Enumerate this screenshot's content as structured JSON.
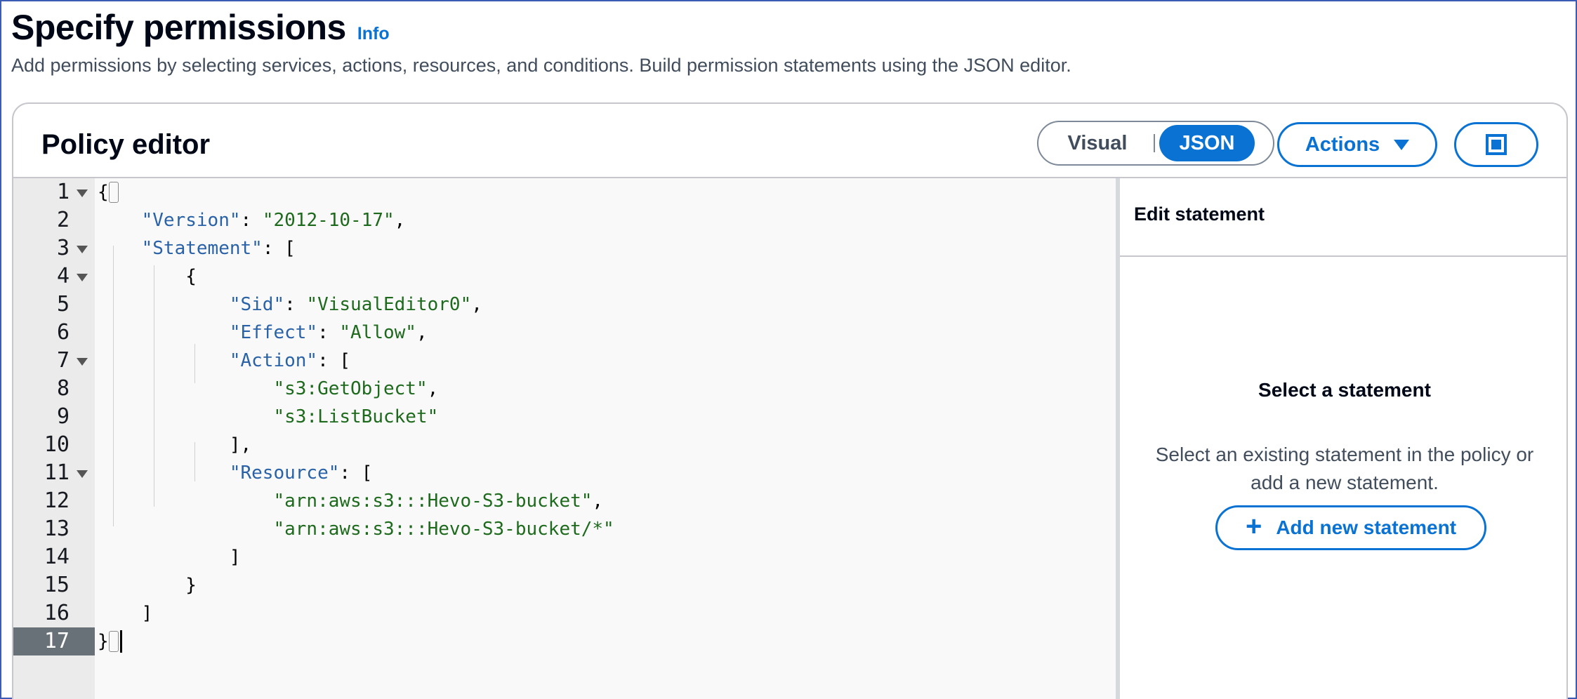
{
  "page": {
    "title": "Specify permissions",
    "info_link": "Info",
    "description": "Add permissions by selecting services, actions, resources, and conditions. Build permission statements using the JSON editor."
  },
  "policy_editor": {
    "title": "Policy editor",
    "mode_visual": "Visual",
    "mode_json": "JSON",
    "selected_mode": "JSON",
    "actions_label": "Actions",
    "panel_toggle_icon": "split-panel-icon"
  },
  "editor": {
    "active_line": 17,
    "lines": [
      {
        "n": "1",
        "fold": true
      },
      {
        "n": "2",
        "fold": false
      },
      {
        "n": "3",
        "fold": true
      },
      {
        "n": "4",
        "fold": true
      },
      {
        "n": "5",
        "fold": false
      },
      {
        "n": "6",
        "fold": false
      },
      {
        "n": "7",
        "fold": true
      },
      {
        "n": "8",
        "fold": false
      },
      {
        "n": "9",
        "fold": false
      },
      {
        "n": "10",
        "fold": false
      },
      {
        "n": "11",
        "fold": true
      },
      {
        "n": "12",
        "fold": false
      },
      {
        "n": "13",
        "fold": false
      },
      {
        "n": "14",
        "fold": false
      },
      {
        "n": "15",
        "fold": false
      },
      {
        "n": "16",
        "fold": false
      },
      {
        "n": "17",
        "fold": false
      }
    ],
    "code": {
      "l1": "{",
      "l2_key": "\"Version\"",
      "l2_val": "\"2012-10-17\"",
      "l3_key": "\"Statement\"",
      "l4": "{",
      "l5_key": "\"Sid\"",
      "l5_val": "\"VisualEditor0\"",
      "l6_key": "\"Effect\"",
      "l6_val": "\"Allow\"",
      "l7_key": "\"Action\"",
      "l8_val": "\"s3:GetObject\"",
      "l9_val": "\"s3:ListBucket\"",
      "l10": "],",
      "l11_key": "\"Resource\"",
      "l12_val": "\"arn:aws:s3:::Hevo-S3-bucket\"",
      "l13_val": "\"arn:aws:s3:::Hevo-S3-bucket/*\"",
      "l14": "]",
      "l15": "}",
      "l16": "]",
      "l17": "}"
    }
  },
  "side_panel": {
    "title": "Edit statement",
    "empty_title": "Select a statement",
    "empty_desc": "Select an existing statement in the policy or add a new statement.",
    "add_button": "Add new statement"
  },
  "colors": {
    "accent": "#0972d3",
    "json_key": "#2a62a8",
    "json_string": "#1d6a1d"
  }
}
